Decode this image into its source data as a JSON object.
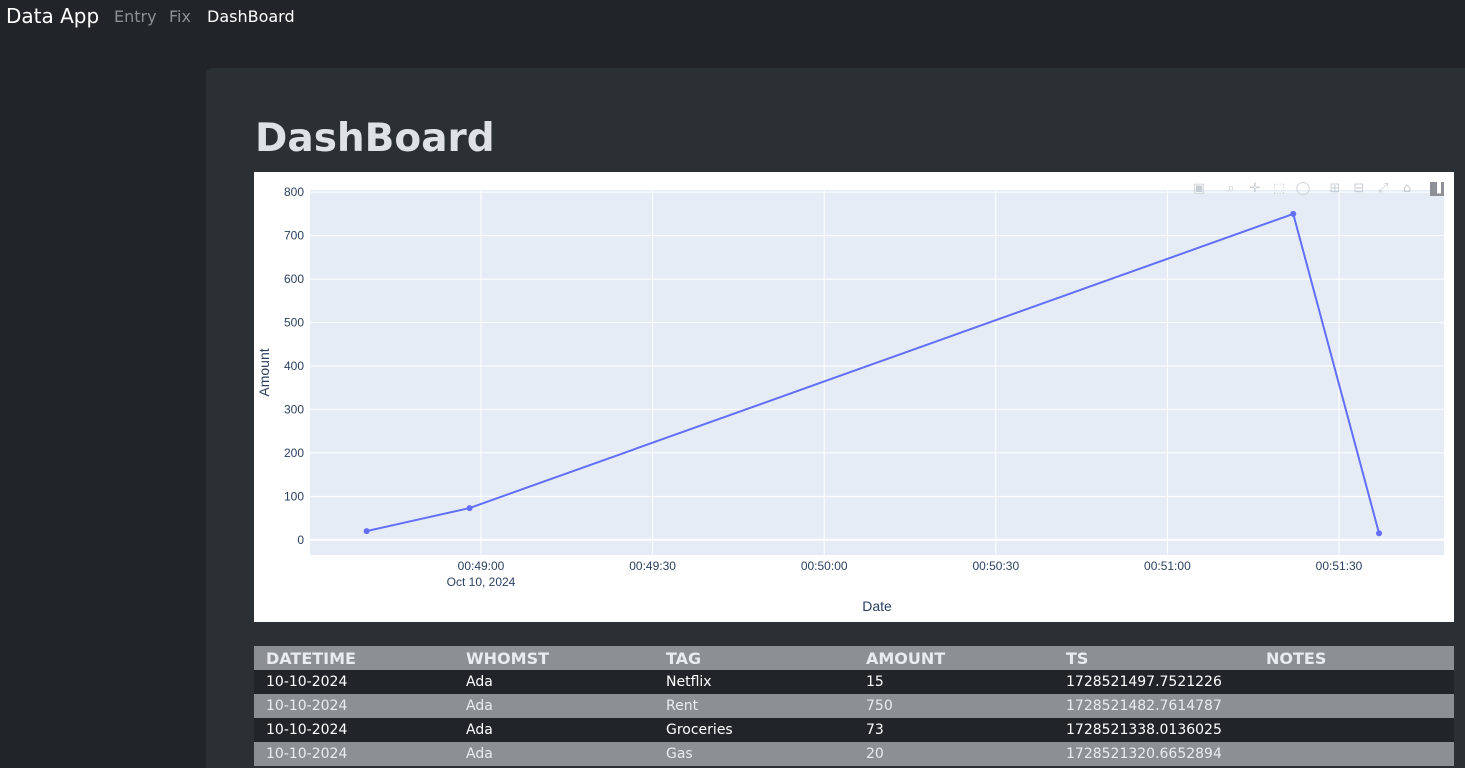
{
  "nav": {
    "brand": "Data App",
    "links": [
      "Entry",
      "Fix",
      "DashBoard"
    ]
  },
  "page": {
    "title": "DashBoard"
  },
  "modebar_icons": [
    "camera-icon",
    "zoom-icon",
    "pan-icon",
    "box-select-icon",
    "lasso-icon",
    "zoom-in-icon",
    "zoom-out-icon",
    "autoscale-icon",
    "reset-axes-icon",
    "plotly-logo-icon"
  ],
  "chart_data": {
    "type": "line",
    "xlabel": "Date",
    "ylabel": "Amount",
    "x": [
      "2024-10-10 00:48:40",
      "2024-10-10 00:48:58",
      "2024-10-10 00:51:22",
      "2024-10-10 00:51:37"
    ],
    "x_ticks": [
      "00:49:00",
      "00:49:30",
      "00:50:00",
      "00:50:30",
      "00:51:00",
      "00:51:30"
    ],
    "x_tick_sublabel": "Oct 10, 2024",
    "y_ticks": [
      0,
      100,
      200,
      300,
      400,
      500,
      600,
      700,
      800
    ],
    "values": [
      20,
      73,
      750,
      15
    ],
    "ylim": [
      -35,
      805
    ],
    "line_color": "#636efa",
    "plot_bg": "#e5ecf6",
    "grid": true
  },
  "table": {
    "columns": [
      "DATETIME",
      "WHOMST",
      "TAG",
      "AMOUNT",
      "TS",
      "NOTES"
    ],
    "rows": [
      [
        "10-10-2024",
        "Ada",
        "Netflix",
        "15",
        "1728521497.7521226",
        ""
      ],
      [
        "10-10-2024",
        "Ada",
        "Rent",
        "750",
        "1728521482.7614787",
        ""
      ],
      [
        "10-10-2024",
        "Ada",
        "Groceries",
        "73",
        "1728521338.0136025",
        ""
      ],
      [
        "10-10-2024",
        "Ada",
        "Gas",
        "20",
        "1728521320.6652894",
        ""
      ]
    ]
  }
}
